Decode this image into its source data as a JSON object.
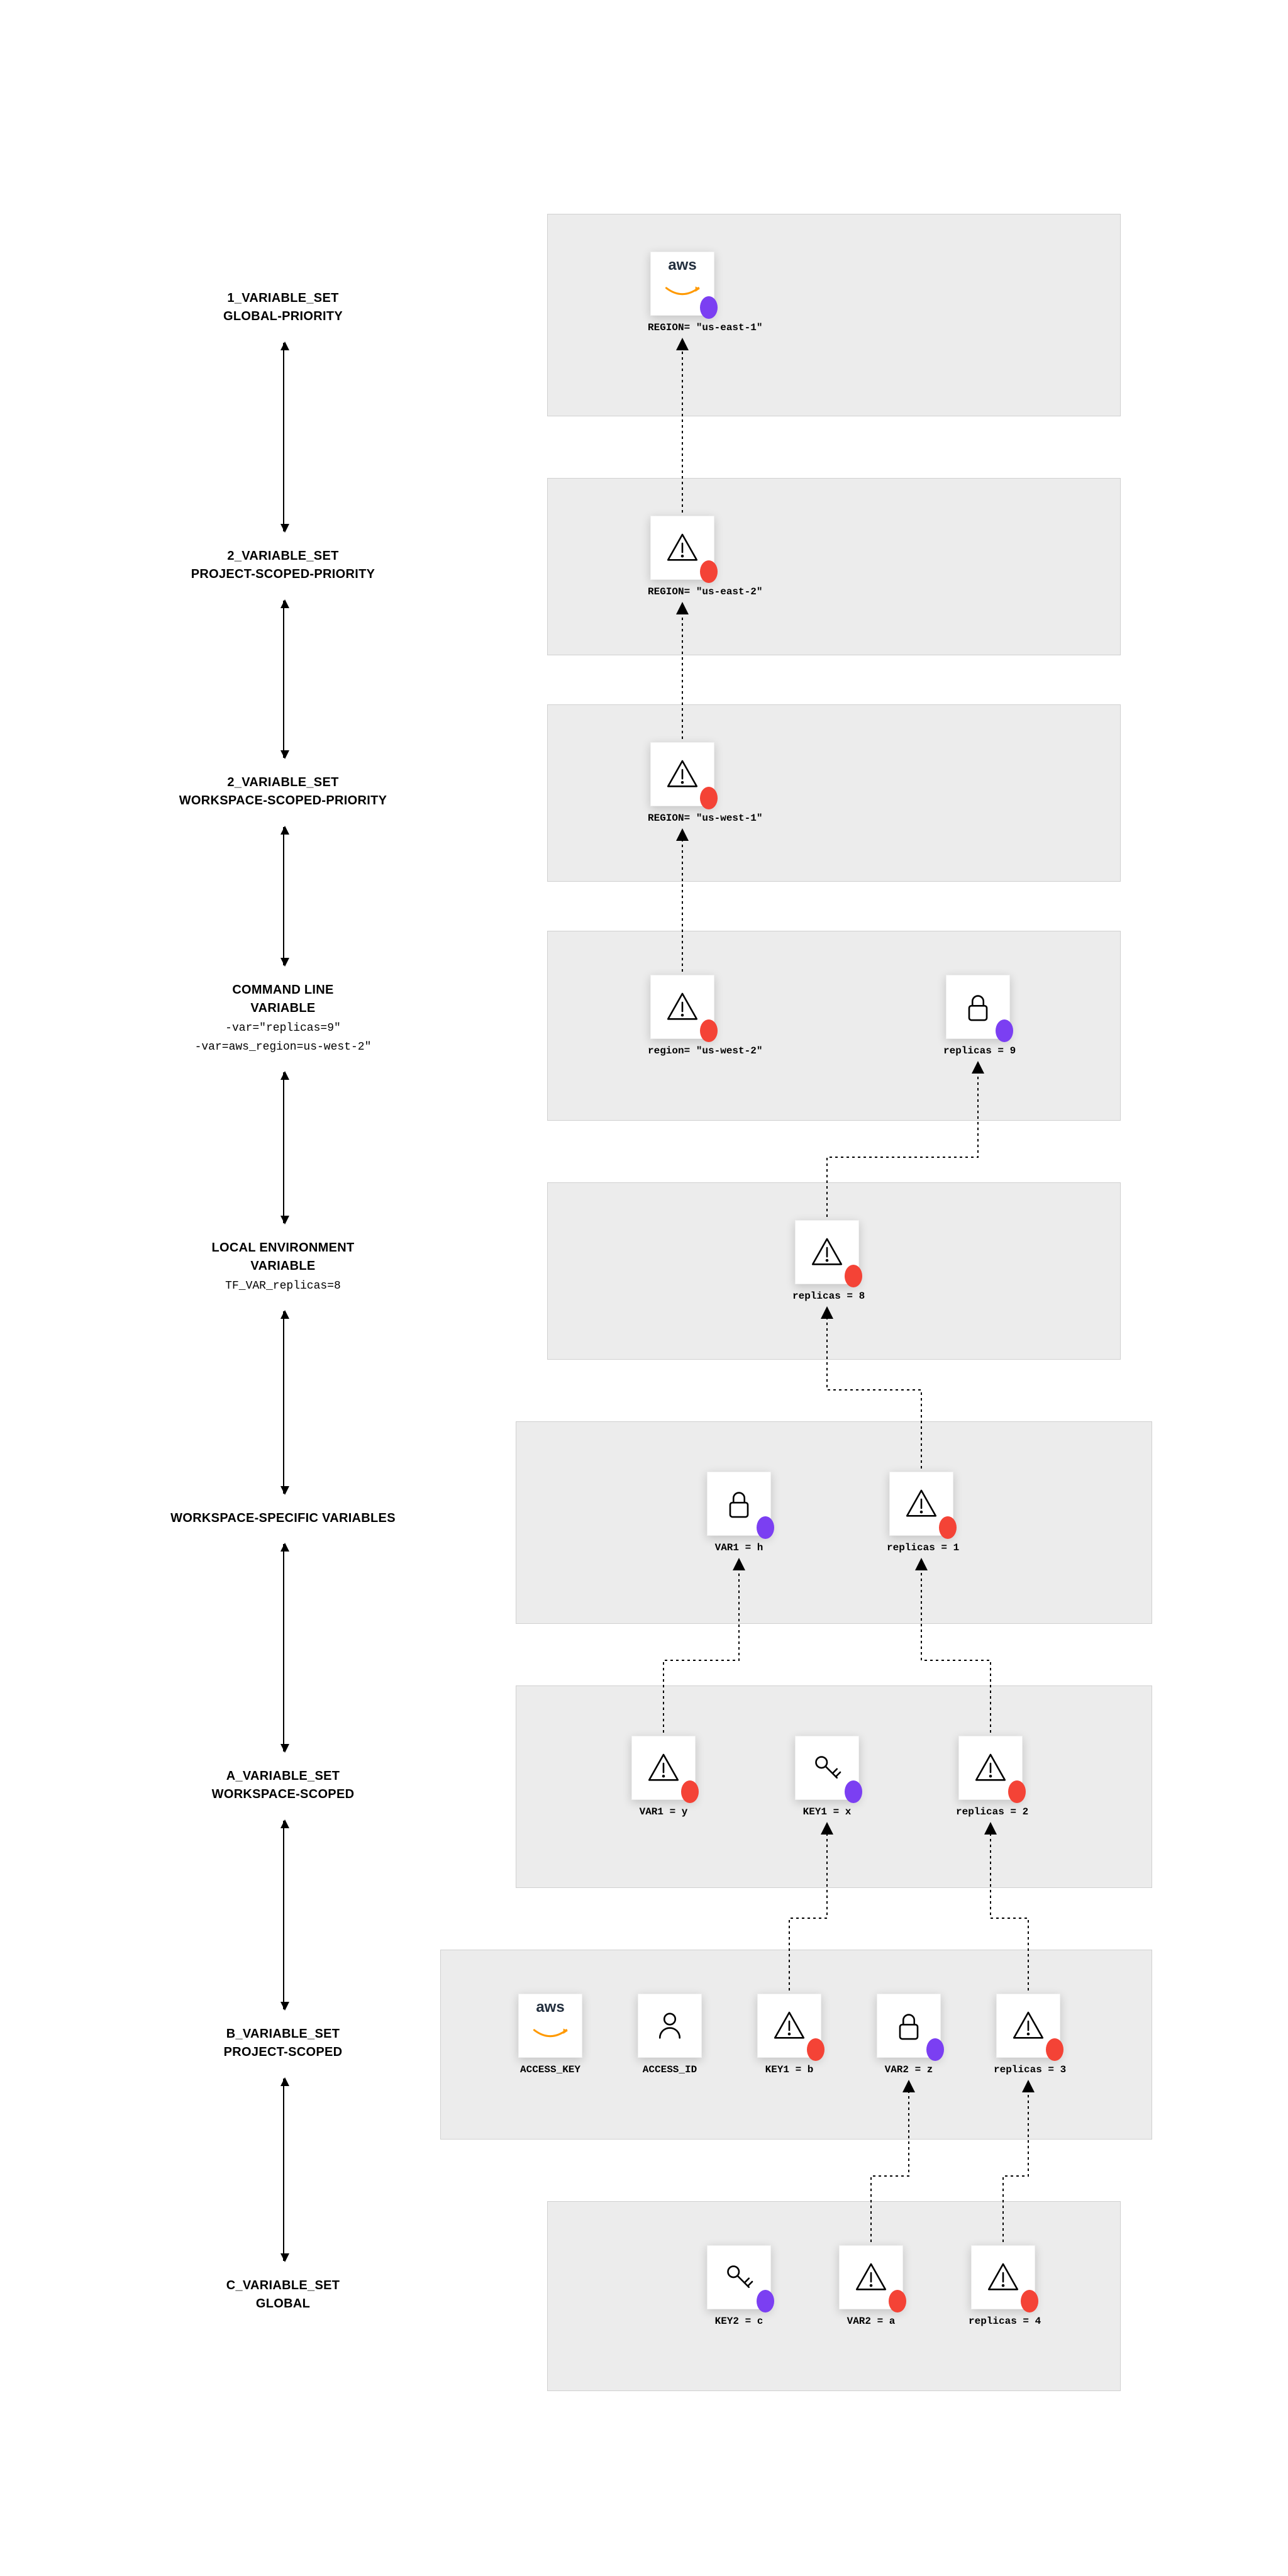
{
  "labels": {
    "l1a": "1_VARIABLE_SET",
    "l1b": "GLOBAL-PRIORITY",
    "l2a": "2_VARIABLE_SET",
    "l2b": "PROJECT-SCOPED-PRIORITY",
    "l3a": "2_VARIABLE_SET",
    "l3b": "WORKSPACE-SCOPED-PRIORITY",
    "l4a": "COMMAND LINE",
    "l4b": "VARIABLE",
    "l4c": "-var=\"replicas=9\"",
    "l4d": "-var=aws_region=us-west-2\"",
    "l5a": "LOCAL ENVIRONMENT",
    "l5b": "VARIABLE",
    "l5c": "TF_VAR_replicas=8",
    "l6a": "WORKSPACE-SPECIFIC VARIABLES",
    "l7a": "A_VARIABLE_SET",
    "l7b": "WORKSPACE-SCOPED",
    "l8a": "B_VARIABLE_SET",
    "l8b": "PROJECT-SCOPED",
    "l9a": "C_VARIABLE_SET",
    "l9b": "GLOBAL"
  },
  "cards": {
    "g1_region": "REGION= \"us-east-1\"",
    "g2_region": "REGION= \"us-east-2\"",
    "g3_region": "REGION= \"us-west-1\"",
    "g4_region": "region= \"us-west-2\"",
    "g4_replicas": "replicas = 9",
    "g5_replicas": "replicas = 8",
    "g6_var1": "VAR1 = h",
    "g6_replicas": "replicas = 1",
    "g7_var1": "VAR1 = y",
    "g7_key1": "KEY1 = x",
    "g7_replicas": "replicas = 2",
    "g8_access_key": "ACCESS_KEY",
    "g8_access_id": "ACCESS_ID",
    "g8_key1": "KEY1 = b",
    "g8_var2": "VAR2 = z",
    "g8_replicas": "replicas = 3",
    "g9_key2": "KEY2 = c",
    "g9_var2": "VAR2 = a",
    "g9_replicas": "replicas = 4"
  }
}
